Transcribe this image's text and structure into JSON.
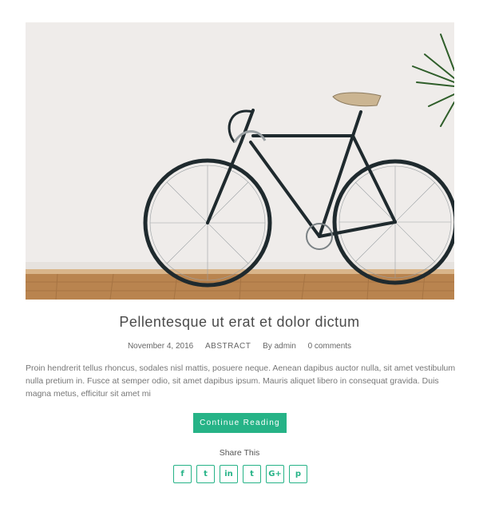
{
  "post": {
    "title": "Pellentesque ut erat et dolor dictum",
    "date": "November 4, 2016",
    "category": "ABSTRACT",
    "author": "By admin",
    "comments": "0 comments",
    "excerpt": "Proin hendrerit tellus rhoncus, sodales nisl mattis, posuere neque. Aenean dapibus auctor nulla, sit amet vestibulum nulla pretium in. Fusce at semper odio, sit amet dapibus ipsum. Mauris aliquet libero in consequat gravida. Duis magna metus, efficitur sit amet mi",
    "read_more_label": "Continue Reading"
  },
  "share": {
    "label": "Share This",
    "icons": [
      {
        "name": "facebook-icon",
        "glyph": "f"
      },
      {
        "name": "twitter-icon",
        "glyph": "t"
      },
      {
        "name": "linkedin-icon",
        "glyph": "in"
      },
      {
        "name": "tumblr-icon",
        "glyph": "t"
      },
      {
        "name": "google-plus-icon",
        "glyph": "G+"
      },
      {
        "name": "pinterest-icon",
        "glyph": "p"
      }
    ]
  },
  "colors": {
    "accent": "#26b387",
    "wall": "#efecea",
    "floor": "#b9844f"
  }
}
